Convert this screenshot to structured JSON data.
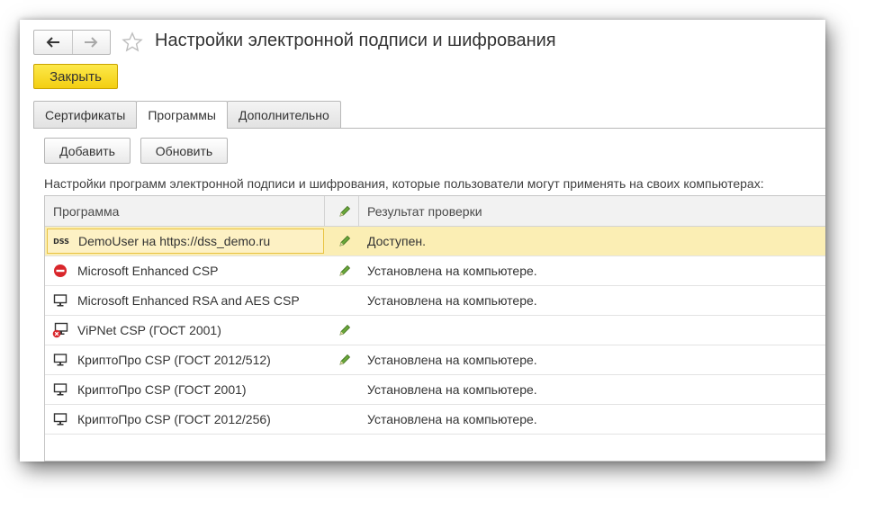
{
  "window": {
    "title": "Настройки электронной подписи и шифрования",
    "back_icon": "arrow-left-icon",
    "forward_icon": "arrow-right-icon",
    "favorite_icon": "star-icon"
  },
  "actions": {
    "close_label": "Закрыть"
  },
  "tabs": [
    {
      "label": "Сертификаты",
      "active": false
    },
    {
      "label": "Программы",
      "active": true
    },
    {
      "label": "Дополнительно",
      "active": false
    }
  ],
  "toolbar": {
    "add_label": "Добавить",
    "refresh_label": "Обновить"
  },
  "hint": "Настройки программ электронной подписи и шифрования, которые пользователи могут применять на своих компьютерах:",
  "table": {
    "columns": {
      "program": "Программа",
      "edit_icon": "pencil-icon",
      "result": "Результат проверки"
    },
    "rows": [
      {
        "icon": "dss-icon",
        "icon_text": "DSS",
        "name": "DemoUser на https://dss_demo.ru",
        "editable": true,
        "result": "Доступен.",
        "selected": true
      },
      {
        "icon": "error-icon",
        "name": "Microsoft Enhanced CSP",
        "editable": true,
        "result": "Установлена на компьютере.",
        "selected": false
      },
      {
        "icon": "computer-icon",
        "name": "Microsoft Enhanced RSA and AES CSP",
        "editable": false,
        "result": "Установлена на компьютере.",
        "selected": false
      },
      {
        "icon": "computer-error-icon",
        "name": "ViPNet CSP (ГОСТ 2001)",
        "editable": true,
        "result": "",
        "selected": false
      },
      {
        "icon": "computer-icon",
        "name": "КриптоПро CSP (ГОСТ 2012/512)",
        "editable": true,
        "result": "Установлена на компьютере.",
        "selected": false
      },
      {
        "icon": "computer-icon",
        "name": "КриптоПро CSP (ГОСТ 2001)",
        "editable": false,
        "result": "Установлена на компьютере.",
        "selected": false
      },
      {
        "icon": "computer-icon",
        "name": "КриптоПро CSP (ГОСТ 2012/256)",
        "editable": false,
        "result": "Установлена на компьютере.",
        "selected": false
      }
    ]
  },
  "colors": {
    "accent_yellow": "#f3cf12",
    "selection": "#fbeeb4",
    "pencil": "#5a9a2e",
    "error": "#d9262b"
  }
}
